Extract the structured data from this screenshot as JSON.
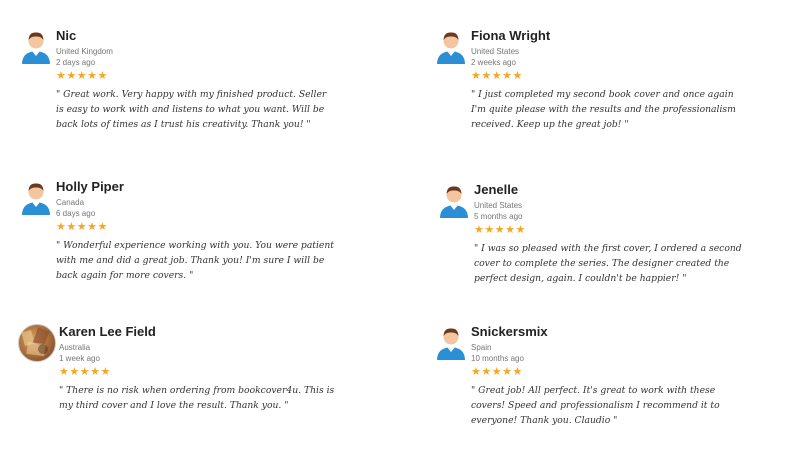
{
  "reviews": [
    {
      "name": "Nic",
      "country": "United Kingdom",
      "time": "2 days ago",
      "stars": "★★★★★",
      "text": "\" Great work. Very happy with my finished product. Seller is easy to work with and listens to what you want. Will be back lots of times as I trust his creativity. Thank you! \"",
      "avatar": "male-user-avatar-icon"
    },
    {
      "name": "Fiona Wright",
      "country": "United States",
      "time": "2 weeks ago",
      "stars": "★★★★★",
      "text": "\" I just completed my second book cover and once again I'm quite please with the results and the professionalism received. Keep up the great job! \"",
      "avatar": "male-user-avatar-icon"
    },
    {
      "name": "Holly Piper",
      "country": "Canada",
      "time": "6 days ago",
      "stars": "★★★★★",
      "text": "\" Wonderful experience working with you. You were patient with me and did a great job. Thank you! I'm sure I will be back again for more covers. \"",
      "avatar": "male-user-avatar-icon"
    },
    {
      "name": "Jenelle",
      "country": "United States",
      "time": "5 months ago",
      "stars": "★★★★★",
      "text": "\" I was so pleased with the first cover, I ordered a second cover to complete the series. The designer created the perfect design, again. I couldn't be happier! \"",
      "avatar": "male-user-avatar-icon"
    },
    {
      "name": "Karen Lee Field",
      "country": "Australia",
      "time": "1 week ago",
      "stars": "★★★★★",
      "text": "\" There is no risk when ordering from bookcover4u. This is my third cover and I love the result. Thank you. \"",
      "avatar": "photo-avatar"
    },
    {
      "name": "Snickersmix",
      "country": "Spain",
      "time": "10 months ago",
      "stars": "★★★★★",
      "text": "\" Great job! All perfect. It's great to work with these covers! Speed and professionalism I recommend it to everyone! Thank you. Claudio \"",
      "avatar": "male-user-avatar-icon"
    }
  ],
  "colors": {
    "star": "#f5a623",
    "meta": "#777777",
    "avatar_shirt": "#2b8fd6"
  }
}
